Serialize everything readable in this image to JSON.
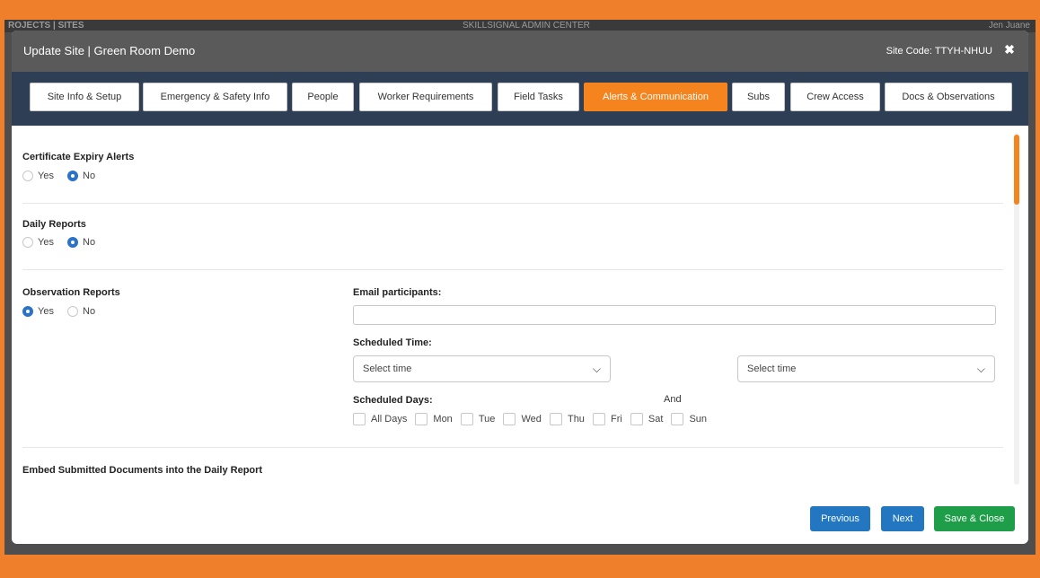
{
  "background": {
    "left_title": "ROJECTS | SITES",
    "center_title": "SKILLSIGNAL ADMIN CENTER",
    "right_user": "Jen Juane"
  },
  "modal": {
    "title": "Update Site | Green Room Demo",
    "site_code": "Site Code: TTYH-NHUU",
    "close_icon": "close-icon"
  },
  "tabs": [
    {
      "label": "Site Info & Setup"
    },
    {
      "label": "Emergency & Safety Info"
    },
    {
      "label": "People"
    },
    {
      "label": "Worker Requirements"
    },
    {
      "label": "Field Tasks"
    },
    {
      "label": "Alerts & Communication",
      "active": true
    },
    {
      "label": "Subs"
    },
    {
      "label": "Crew Access"
    },
    {
      "label": "Docs & Observations"
    }
  ],
  "sections": {
    "certificate_expiry": {
      "label": "Certificate Expiry Alerts",
      "yes": "Yes",
      "no": "No",
      "selected": "No"
    },
    "daily_reports": {
      "label": "Daily Reports",
      "yes": "Yes",
      "no": "No",
      "selected": "No"
    },
    "observation_reports": {
      "label": "Observation Reports",
      "yes": "Yes",
      "no": "No",
      "selected": "Yes"
    },
    "embed_documents": {
      "label": "Embed Submitted Documents into the Daily Report"
    }
  },
  "observation_settings": {
    "email_label": "Email participants:",
    "email_value": "",
    "scheduled_time_label": "Scheduled Time:",
    "time_from_placeholder": "Select time",
    "and_label": "And",
    "time_to_placeholder": "Select time",
    "scheduled_days_label": "Scheduled Days:",
    "days": [
      "All Days",
      "Mon",
      "Tue",
      "Wed",
      "Thu",
      "Fri",
      "Sat",
      "Sun"
    ]
  },
  "buttons": {
    "previous": "Previous",
    "next": "Next",
    "save_close": "Save & Close"
  },
  "colors": {
    "accent_orange": "#f5841f",
    "header_dark": "#5a5a5a",
    "tab_bar": "#2d3e55",
    "primary_blue": "#2277c0",
    "success_green": "#1e9e48",
    "radio_blue": "#2b72c9"
  }
}
